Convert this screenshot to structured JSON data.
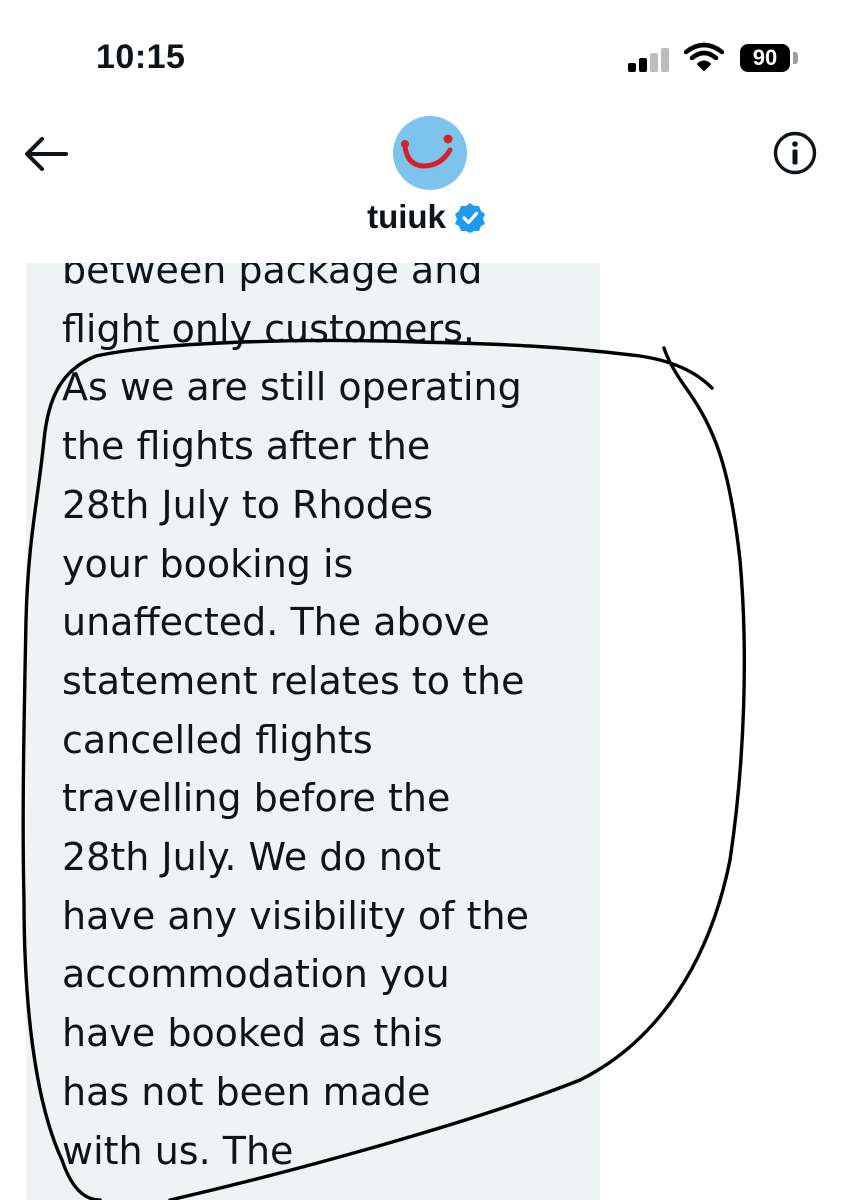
{
  "status_bar": {
    "time": "10:15",
    "battery": "90",
    "signal_icon": "cellular-signal-icon",
    "wifi_icon": "wifi-icon"
  },
  "header": {
    "handle": "tuiuk",
    "back_icon": "arrow-left-icon",
    "info_icon": "info-circle-icon",
    "verified_icon": "verified-badge-icon",
    "avatar_icon": "tui-smile-logo"
  },
  "message": {
    "lines": [
      "between package and",
      "flight only customers.",
      "As we are still operating",
      "the flights after the",
      "28th July to Rhodes",
      "your booking is",
      "unaffected. The above",
      "statement relates to the",
      "cancelled flights",
      "travelling before the",
      "28th July. We do not",
      "have any visibility of the",
      "accommodation you",
      "have booked as this",
      "has not been made",
      "with us.  The"
    ]
  },
  "colors": {
    "bubble_bg": "#eff3f4",
    "avatar_bg": "#7cc4ec",
    "logo_red": "#d62128",
    "verified_blue": "#1d9bf0"
  }
}
